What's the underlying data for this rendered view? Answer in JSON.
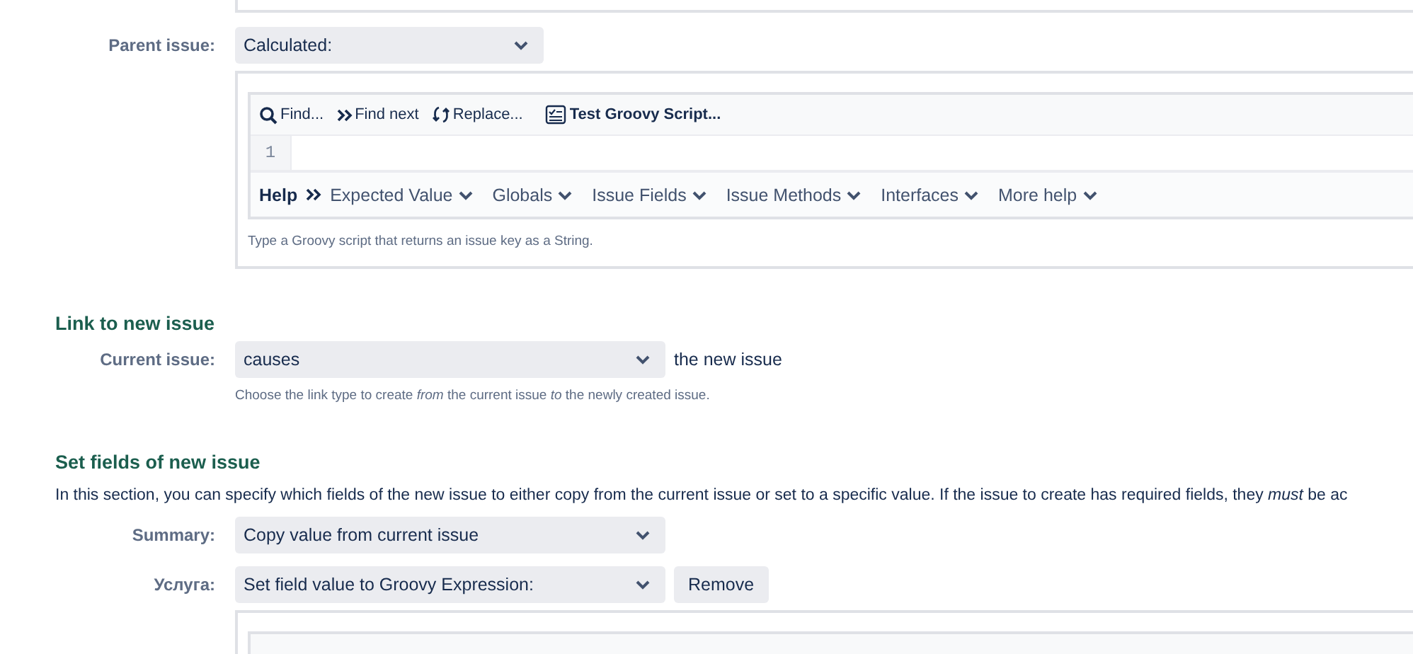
{
  "parent_issue": {
    "label": "Parent issue:",
    "value": "Calculated:",
    "editor": {
      "toolbar": [
        {
          "kind": "search",
          "label": "Find..."
        },
        {
          "kind": "next",
          "label": "Find next"
        },
        {
          "kind": "replace",
          "label": "Replace..."
        },
        {
          "kind": "test",
          "label": "Test Groovy Script..."
        }
      ],
      "line_numbers": [
        "1"
      ],
      "help": {
        "label": "Help",
        "menus": [
          "Expected Value",
          "Globals",
          "Issue Fields",
          "Issue Methods",
          "Interfaces",
          "More help"
        ]
      },
      "hint": "Type a Groovy script that returns an issue key as a String."
    }
  },
  "link_section": {
    "title": "Link to new issue",
    "label": "Current issue:",
    "value": "causes",
    "suffix": "the new issue",
    "hint": "Choose the link type to create *from* the current issue *to* the newly created issue."
  },
  "fields_section": {
    "title": "Set fields of new issue",
    "description": "In this section, you can specify which fields of the new issue to either copy from the current issue or set to a specific value. If the issue to create has required fields, they *must* be ac",
    "rows": [
      {
        "label": "Summary:",
        "value": "Copy value from current issue"
      },
      {
        "label": "Услуга:",
        "value": "Set field value to Groovy Expression:",
        "button": "Remove"
      }
    ]
  }
}
